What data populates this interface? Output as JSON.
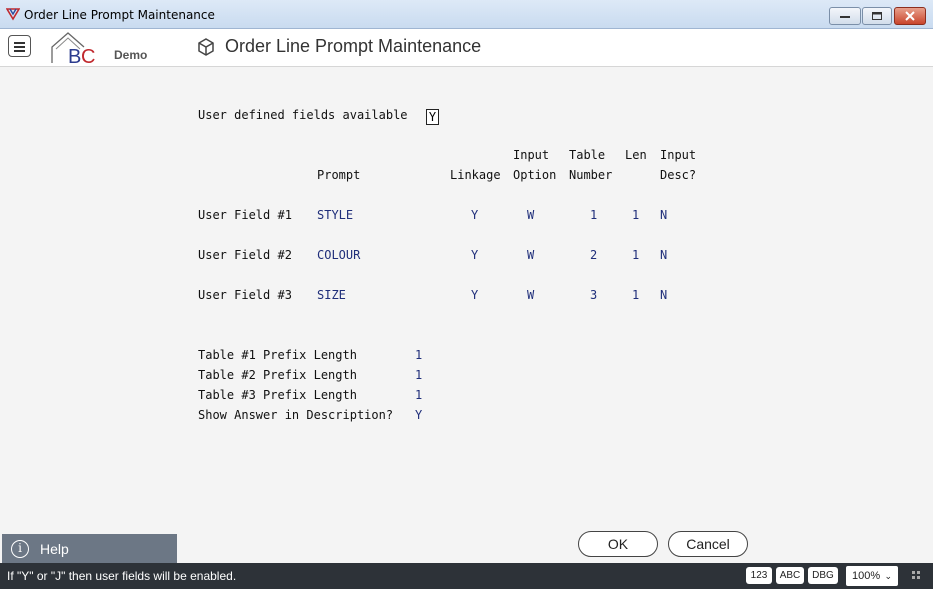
{
  "window": {
    "title": "Order Line Prompt Maintenance"
  },
  "header": {
    "brand_sub": "Demo",
    "page_title": "Order Line Prompt Maintenance"
  },
  "form": {
    "udf_label": "User defined fields available",
    "udf_value": "Y",
    "columns": {
      "prompt": "Prompt",
      "linkage": "Linkage",
      "input_option_1": "Input",
      "input_option_2": "Option",
      "table_number_1": "Table",
      "table_number_2": "Number",
      "len": "Len",
      "input_desc_1": "Input",
      "input_desc_2": "Desc?"
    },
    "rows": [
      {
        "label": "User Field #1",
        "prompt": "STYLE",
        "linkage": "Y",
        "input_option": "W",
        "table_number": "1",
        "len": "1",
        "input_desc": "N"
      },
      {
        "label": "User Field #2",
        "prompt": "COLOUR",
        "linkage": "Y",
        "input_option": "W",
        "table_number": "2",
        "len": "1",
        "input_desc": "N"
      },
      {
        "label": "User Field #3",
        "prompt": "SIZE",
        "linkage": "Y",
        "input_option": "W",
        "table_number": "3",
        "len": "1",
        "input_desc": "N"
      }
    ],
    "prefix": [
      {
        "label": "Table #1 Prefix Length",
        "value": "1"
      },
      {
        "label": "Table #2 Prefix Length",
        "value": "1"
      },
      {
        "label": "Table #3 Prefix Length",
        "value": "1"
      },
      {
        "label": "Show Answer in Description?",
        "value": "Y"
      }
    ]
  },
  "buttons": {
    "ok": "OK",
    "cancel": "Cancel"
  },
  "help": {
    "label": "Help"
  },
  "status": {
    "message": "If \"Y\" or \"J\" then user fields will be enabled.",
    "indicators": [
      "123",
      "ABC",
      "DBG"
    ],
    "zoom": "100%"
  },
  "colors": {
    "value_blue": "#1f2e7a",
    "status_bg": "#2d3238",
    "help_bg": "#6c7785"
  }
}
